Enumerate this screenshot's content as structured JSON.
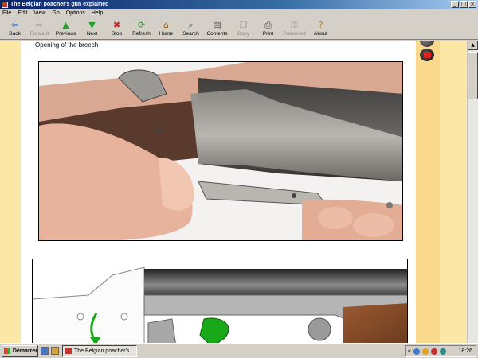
{
  "window": {
    "title": "The Belgian poacher's gun explained"
  },
  "menu": [
    "File",
    "Edit",
    "View",
    "Go",
    "Options",
    "Help"
  ],
  "toolbar": [
    {
      "label": "Back",
      "icon": "back-arrow-icon",
      "glyph": "⇦",
      "color": "#2a6fc9",
      "disabled": false
    },
    {
      "label": "Forward",
      "icon": "forward-arrow-icon",
      "glyph": "⇨",
      "color": "#9a9a9a",
      "disabled": true
    },
    {
      "label": "Previous",
      "icon": "previous-arrow-icon",
      "glyph": "▲",
      "color": "#22a02a",
      "disabled": false
    },
    {
      "label": "Next",
      "icon": "next-arrow-icon",
      "glyph": "▼",
      "color": "#22a02a",
      "disabled": false
    },
    {
      "label": "Stop",
      "icon": "stop-icon",
      "glyph": "✖",
      "color": "#d02020",
      "disabled": false
    },
    {
      "label": "Refresh",
      "icon": "refresh-icon",
      "glyph": "⟳",
      "color": "#2a8a2a",
      "disabled": false
    },
    {
      "label": "Home",
      "icon": "home-icon",
      "glyph": "⌂",
      "color": "#a06010",
      "disabled": false
    },
    {
      "label": "Search",
      "icon": "search-icon",
      "glyph": "⌕",
      "color": "#305070",
      "disabled": false
    },
    {
      "label": "Contents",
      "icon": "contents-icon",
      "glyph": "▤",
      "color": "#505050",
      "disabled": false
    },
    {
      "label": "Copy",
      "icon": "copy-icon",
      "glyph": "❐",
      "color": "#9a9a9a",
      "disabled": true
    },
    {
      "label": "Print",
      "icon": "print-icon",
      "glyph": "⎙",
      "color": "#404040",
      "disabled": false
    },
    {
      "label": "Password",
      "icon": "key-icon",
      "glyph": "⚿",
      "color": "#9a9a9a",
      "disabled": true
    },
    {
      "label": "About",
      "icon": "about-icon",
      "glyph": "?",
      "color": "#b08010",
      "disabled": false
    }
  ],
  "page": {
    "heading": "Opening of the breech"
  },
  "taskbar": {
    "start_label": "Démarrer",
    "task_label": "The Belgian poacher's ...",
    "clock": "18:26",
    "tray_prefix": "«"
  },
  "colors": {
    "page_background": "#fde7a7",
    "side_strip": "#fbd98c",
    "trigger_green": "#18a818",
    "stock_wood": "#8a4f2a"
  }
}
